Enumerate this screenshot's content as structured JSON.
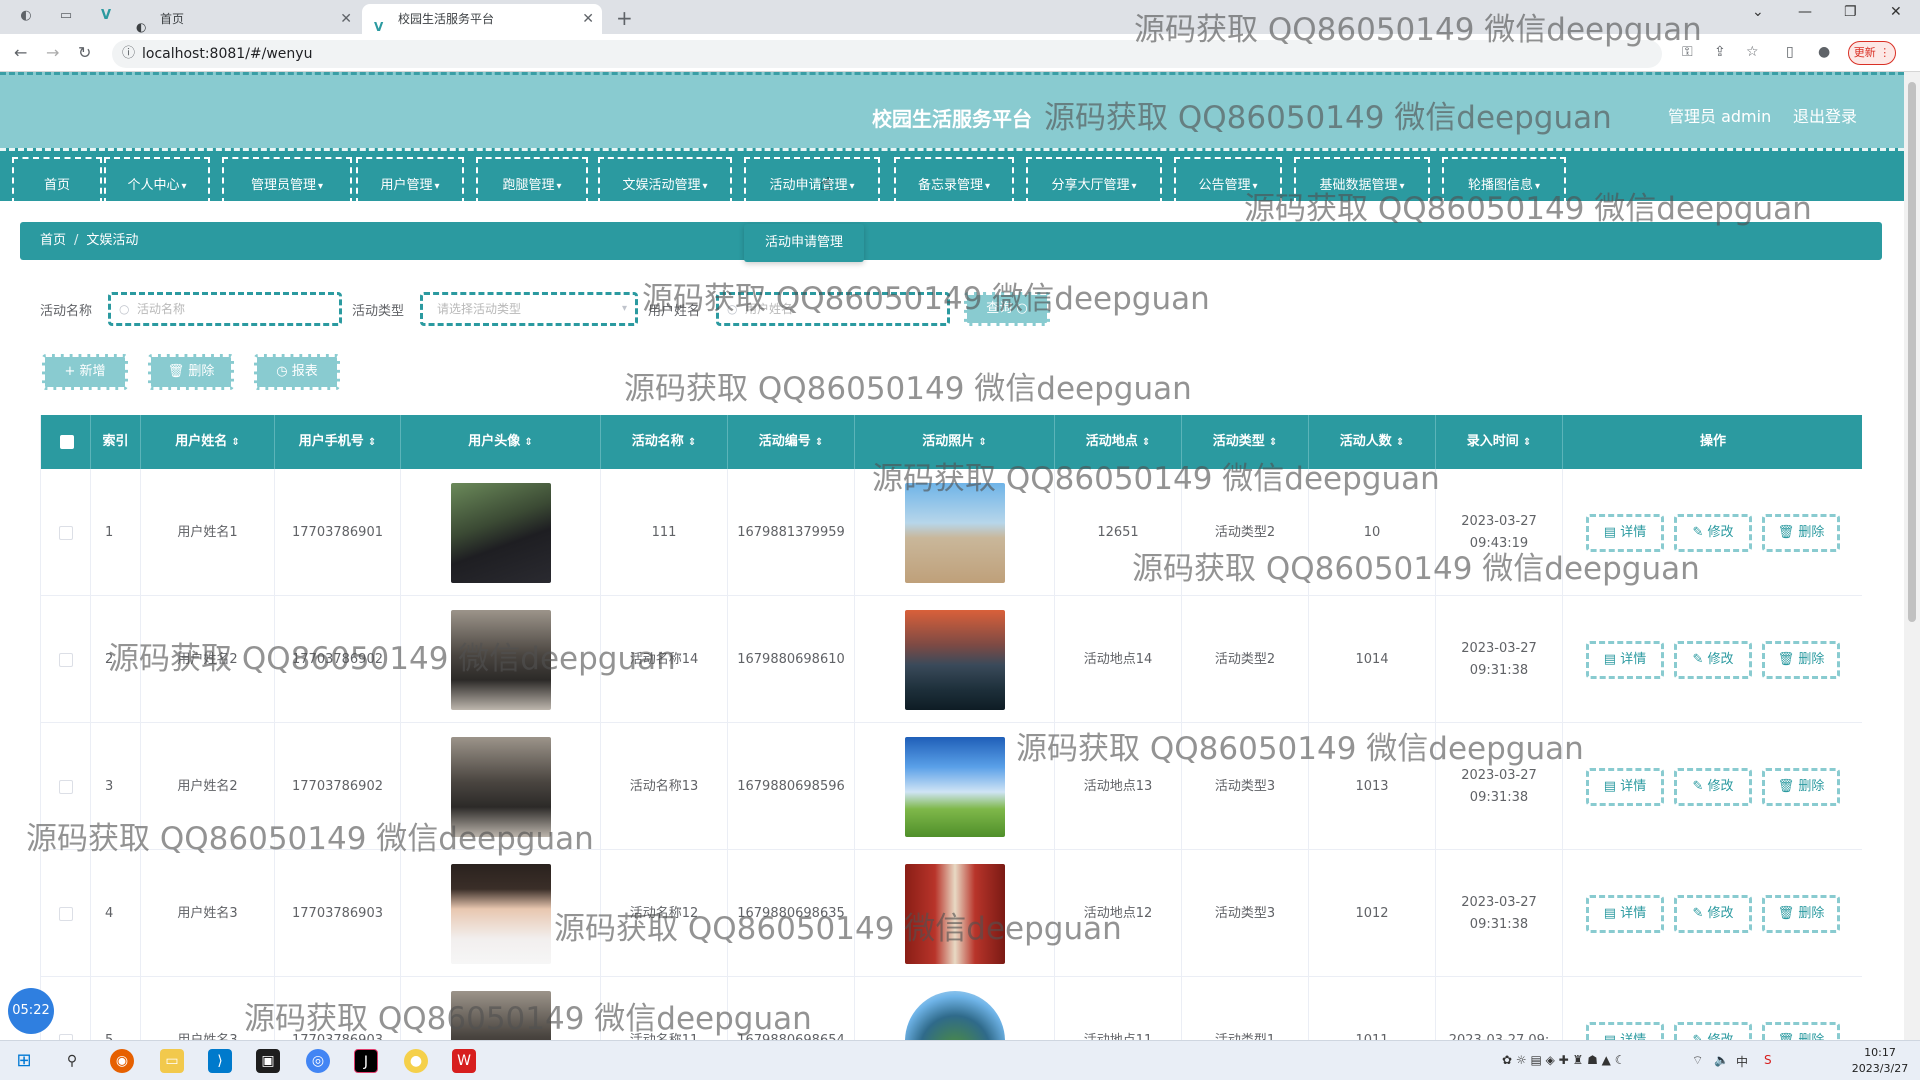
{
  "browser": {
    "tabs": [
      {
        "label": "首页",
        "active": false
      },
      {
        "label": "校园生活服务平台",
        "active": true
      }
    ],
    "url": "localhost:8081/#/wenyu",
    "update_label": "更新"
  },
  "header": {
    "title": "校园生活服务平台",
    "user_label": "管理员 admin",
    "logout_label": "退出登录"
  },
  "menu": [
    {
      "label": "首页",
      "has_dropdown": false
    },
    {
      "label": "个人中心",
      "has_dropdown": true
    },
    {
      "label": "管理员管理",
      "has_dropdown": true
    },
    {
      "label": "用户管理",
      "has_dropdown": true
    },
    {
      "label": "跑腿管理",
      "has_dropdown": true
    },
    {
      "label": "文娱活动管理",
      "has_dropdown": true
    },
    {
      "label": "活动申请管理",
      "has_dropdown": true
    },
    {
      "label": "备忘录管理",
      "has_dropdown": true
    },
    {
      "label": "分享大厅管理",
      "has_dropdown": true
    },
    {
      "label": "公告管理",
      "has_dropdown": true
    },
    {
      "label": "基础数据管理",
      "has_dropdown": true
    },
    {
      "label": "轮播图信息",
      "has_dropdown": true
    }
  ],
  "dropdown_open": {
    "label": "活动申请管理"
  },
  "breadcrumb": {
    "home": "首页",
    "current": "文娱活动"
  },
  "search": {
    "name_label": "活动名称",
    "name_placeholder": "活动名称",
    "type_label": "活动类型",
    "type_placeholder": "请选择活动类型",
    "user_label": "用户姓名",
    "user_placeholder": "用户姓名",
    "query_label": "查询"
  },
  "actions": {
    "add_label": "新增",
    "delete_label": "删除",
    "report_label": "报表"
  },
  "table": {
    "columns": [
      "索引",
      "用户姓名",
      "用户手机号",
      "用户头像",
      "活动名称",
      "活动编号",
      "活动照片",
      "活动地点",
      "活动类型",
      "活动人数",
      "录入时间",
      "操作"
    ],
    "op_labels": {
      "detail": "详情",
      "edit": "修改",
      "delete": "删除"
    },
    "rows": [
      {
        "index": "1",
        "user_name": "用户姓名1",
        "phone": "17703786901",
        "activity_name": "111",
        "number": "1679881379959",
        "location": "12651",
        "type": "活动类型2",
        "people": "10",
        "time": "2023-03-27 09:43:19"
      },
      {
        "index": "2",
        "user_name": "用户姓名2",
        "phone": "17703786902",
        "activity_name": "活动名称14",
        "number": "1679880698610",
        "location": "活动地点14",
        "type": "活动类型2",
        "people": "1014",
        "time": "2023-03-27 09:31:38"
      },
      {
        "index": "3",
        "user_name": "用户姓名2",
        "phone": "17703786902",
        "activity_name": "活动名称13",
        "number": "1679880698596",
        "location": "活动地点13",
        "type": "活动类型3",
        "people": "1013",
        "time": "2023-03-27 09:31:38"
      },
      {
        "index": "4",
        "user_name": "用户姓名3",
        "phone": "17703786903",
        "activity_name": "活动名称12",
        "number": "1679880698635",
        "location": "活动地点12",
        "type": "活动类型3",
        "people": "1012",
        "time": "2023-03-27 09:31:38"
      },
      {
        "index": "5",
        "user_name": "用户姓名3",
        "phone": "17703786903",
        "activity_name": "活动名称11",
        "number": "1679880698654",
        "location": "活动地点11",
        "type": "活动类型1",
        "people": "1011",
        "time": "2023-03-27 09:"
      }
    ]
  },
  "watermark": "源码获取 QQ86050149 微信deepguan",
  "timer": "05:22",
  "taskbar": {
    "time": "10:17",
    "date": "2023/3/27",
    "ime": "中"
  }
}
